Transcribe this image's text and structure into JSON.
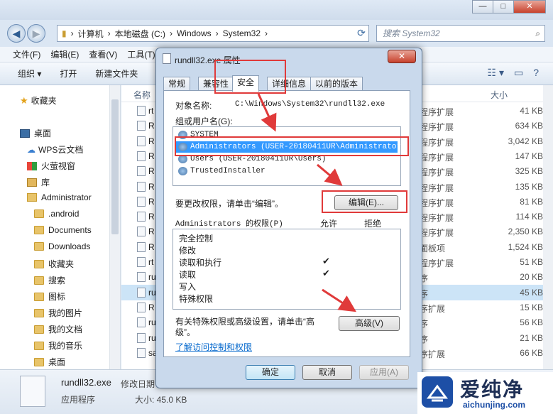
{
  "explorer": {
    "window_buttons": {
      "minimize": "—",
      "maximize": "□",
      "close": "✕"
    },
    "breadcrumb": [
      "计算机",
      "本地磁盘 (C:)",
      "Windows",
      "System32"
    ],
    "search_placeholder": "搜索 System32",
    "menu": [
      "文件(F)",
      "编辑(E)",
      "查看(V)",
      "工具(T)"
    ],
    "toolbar": {
      "organize": "组织 ▾",
      "open": "打开",
      "new_folder": "新建文件夹"
    },
    "nav": {
      "favorites": "收藏夹",
      "desktop": "桌面",
      "wps_cloud": "WPS云文档",
      "huorong": "火萤视窗",
      "library": "库",
      "administrator": "Administrator",
      "folders": [
        ".android",
        "Documents",
        "Downloads",
        "收藏夹",
        "搜索",
        "图标",
        "我的图片",
        "我的文档",
        "我的音乐",
        "桌面"
      ]
    },
    "columns": {
      "name": "名称",
      "size": "大小"
    },
    "files": [
      {
        "name": "rt",
        "type": "程序扩展",
        "size": "41 KB"
      },
      {
        "name": "R",
        "type": "程序扩展",
        "size": "634 KB"
      },
      {
        "name": "R",
        "type": "程序扩展",
        "size": "3,042 KB"
      },
      {
        "name": "R",
        "type": "程序扩展",
        "size": "147 KB"
      },
      {
        "name": "R",
        "type": "程序扩展",
        "size": "325 KB"
      },
      {
        "name": "R",
        "type": "程序扩展",
        "size": "135 KB"
      },
      {
        "name": "R",
        "type": "程序扩展",
        "size": "81 KB"
      },
      {
        "name": "R",
        "type": "程序扩展",
        "size": "114 KB"
      },
      {
        "name": "R",
        "type": "程序扩展",
        "size": "2,350 KB"
      },
      {
        "name": "R",
        "type": "面板项",
        "size": "1,524 KB"
      },
      {
        "name": "rt",
        "type": "程序扩展",
        "size": "51 KB"
      },
      {
        "name": "ru",
        "type": "序",
        "size": "20 KB"
      },
      {
        "name": "ru",
        "type": "序",
        "size": "45 KB"
      },
      {
        "name": "R",
        "type": "序扩展",
        "size": "15 KB"
      },
      {
        "name": "ru",
        "type": "序",
        "size": "56 KB"
      },
      {
        "name": "ru",
        "type": "序",
        "size": "21 KB"
      },
      {
        "name": "sa",
        "type": "序扩展",
        "size": "66 KB"
      }
    ],
    "status": {
      "filename": "rundll32.exe",
      "modified_label": "修改日期",
      "type": "应用程序",
      "size": "大小: 45.0 KB"
    }
  },
  "dialog": {
    "title": "rundll32.exe 属性",
    "close": "✕",
    "tabs": [
      "常规",
      "兼容性",
      "安全",
      "详细信息",
      "以前的版本"
    ],
    "object_label": "对象名称:",
    "object_value": "C:\\Windows\\System32\\rundll32.exe",
    "groups_label": "组或用户名(G):",
    "groups": [
      "SYSTEM",
      "Administrators (USER-20180411UR\\Administrators)",
      "Users (USER-20180411UR\\Users)",
      "TrustedInstaller"
    ],
    "change_text": "要更改权限，请单击“编辑”。",
    "edit_button": "编辑(E)...",
    "permissions_label": "Administrators 的权限(P)",
    "allow": "允许",
    "deny": "拒绝",
    "permissions": [
      {
        "name": "完全控制",
        "allow": ""
      },
      {
        "name": "修改",
        "allow": ""
      },
      {
        "name": "读取和执行",
        "allow": "✔"
      },
      {
        "name": "读取",
        "allow": "✔"
      },
      {
        "name": "写入",
        "allow": ""
      },
      {
        "name": "特殊权限",
        "allow": ""
      }
    ],
    "advanced_text_1": "有关特殊权限或高级设置，请单击“高",
    "advanced_text_2": "级”。",
    "advanced_button": "高级(V)",
    "learn_link": "了解访问控制和权限",
    "ok": "确定",
    "cancel": "取消",
    "apply": "应用(A)"
  },
  "brand": {
    "name": "爱纯净",
    "url": "aichunjing.com"
  },
  "colors": {
    "highlight": "#e03a3a",
    "selection": "#3399ff",
    "brand": "#1d4fa6"
  }
}
